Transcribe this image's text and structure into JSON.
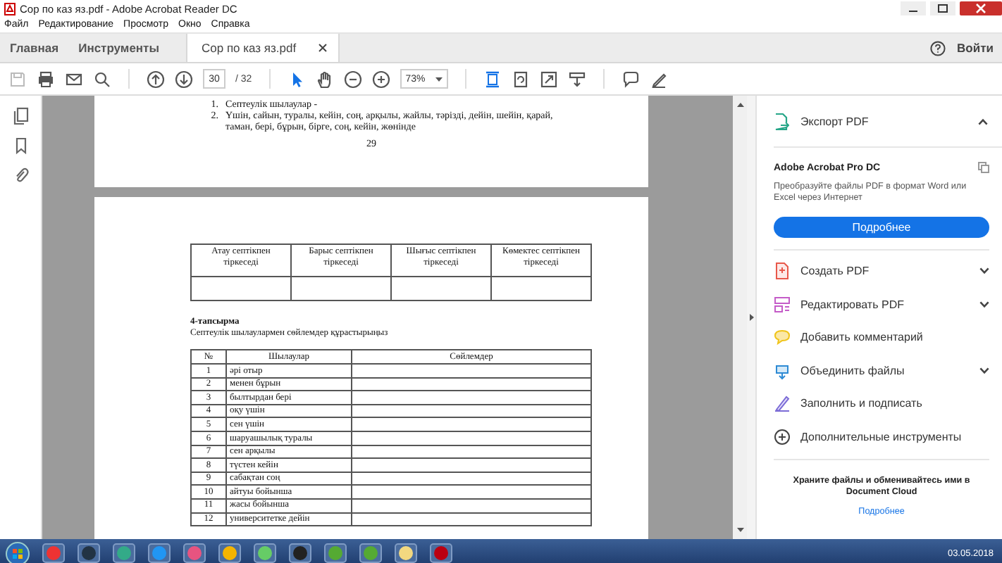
{
  "window": {
    "title": "Сор по каз яз.pdf - Adobe Acrobat Reader DC"
  },
  "menu": [
    "Файл",
    "Редактирование",
    "Просмотр",
    "Окно",
    "Справка"
  ],
  "tabs": [
    {
      "label": "Главная",
      "selected": false,
      "kind": "home"
    },
    {
      "label": "Инструменты",
      "selected": false,
      "kind": "home"
    },
    {
      "label": "Сор по каз яз.pdf",
      "selected": true,
      "kind": "document"
    }
  ],
  "sign_in": "Войти",
  "toolbar": {
    "page": "30",
    "page_total": "/ 32",
    "zoom": "73%"
  },
  "document": {
    "page_1": {
      "list": [
        {
          "number": "1.",
          "text": "Септеулік шылаулар  -"
        },
        {
          "number": "2.",
          "text": "Үшін, сайын, туралы, кейін, соң, арқылы, жайлы, тәрізді, дейін, шейін, қарай, таман, бері, бұрын, бірге, соң, кейін, жөнінде"
        }
      ],
      "page_number": "29"
    },
    "page_2": {
      "table_1": {
        "columns": [
          "Атау септікпен тіркеседі",
          "Барыс септікпен тіркеседі",
          "Шығыс септікпен тіркеседі",
          "Көмектес септікпен тіркеседі"
        ]
      },
      "task_title": "4-тапсырма",
      "task_text": "Септеулік шылаулармен сөйлемдер құрастырыңыз",
      "table_2": {
        "columns": [
          "№",
          "Шылаулар",
          "Сөйлемдер"
        ],
        "rows": [
          [
            "1",
            "әрі отыр"
          ],
          [
            "2",
            "менен бұрын"
          ],
          [
            "3",
            "былтырдан бері"
          ],
          [
            "4",
            "оқу үшін"
          ],
          [
            "5",
            "сен үшін"
          ],
          [
            "6",
            "шаруашылық туралы"
          ],
          [
            "7",
            "сен арқылы"
          ],
          [
            "8",
            "түстен кейін"
          ],
          [
            "9",
            "сабақтан соң"
          ],
          [
            "10",
            "айтуы бойынша"
          ],
          [
            "11",
            "жасы бойынша"
          ],
          [
            "12",
            "университетке дейін"
          ]
        ]
      }
    }
  },
  "tools_pane": {
    "export": {
      "label": "Экспорт PDF",
      "expanded": true
    },
    "promo": {
      "title": "Adobe Acrobat Pro DC",
      "text": "Преобразуйте файлы PDF в формат Word или Excel через Интернет",
      "button": "Подробнее"
    },
    "tools": [
      {
        "label": "Создать PDF",
        "kind": "create",
        "has_menu": true
      },
      {
        "label": "Редактировать PDF",
        "kind": "edit",
        "has_menu": true
      },
      {
        "label": "Добавить комментарий",
        "kind": "comment",
        "has_menu": false
      },
      {
        "label": "Объединить файлы",
        "kind": "combine",
        "has_menu": true
      },
      {
        "label": "Заполнить и подписать",
        "kind": "sign",
        "has_menu": false
      },
      {
        "label": "Дополнительные инструменты",
        "kind": "more",
        "has_menu": false
      }
    ],
    "footer": {
      "text": "Храните файлы и обменивайтесь ими в Document Cloud",
      "link": "Подробнее"
    }
  },
  "taskbar": {
    "date": "03.05.2018"
  }
}
